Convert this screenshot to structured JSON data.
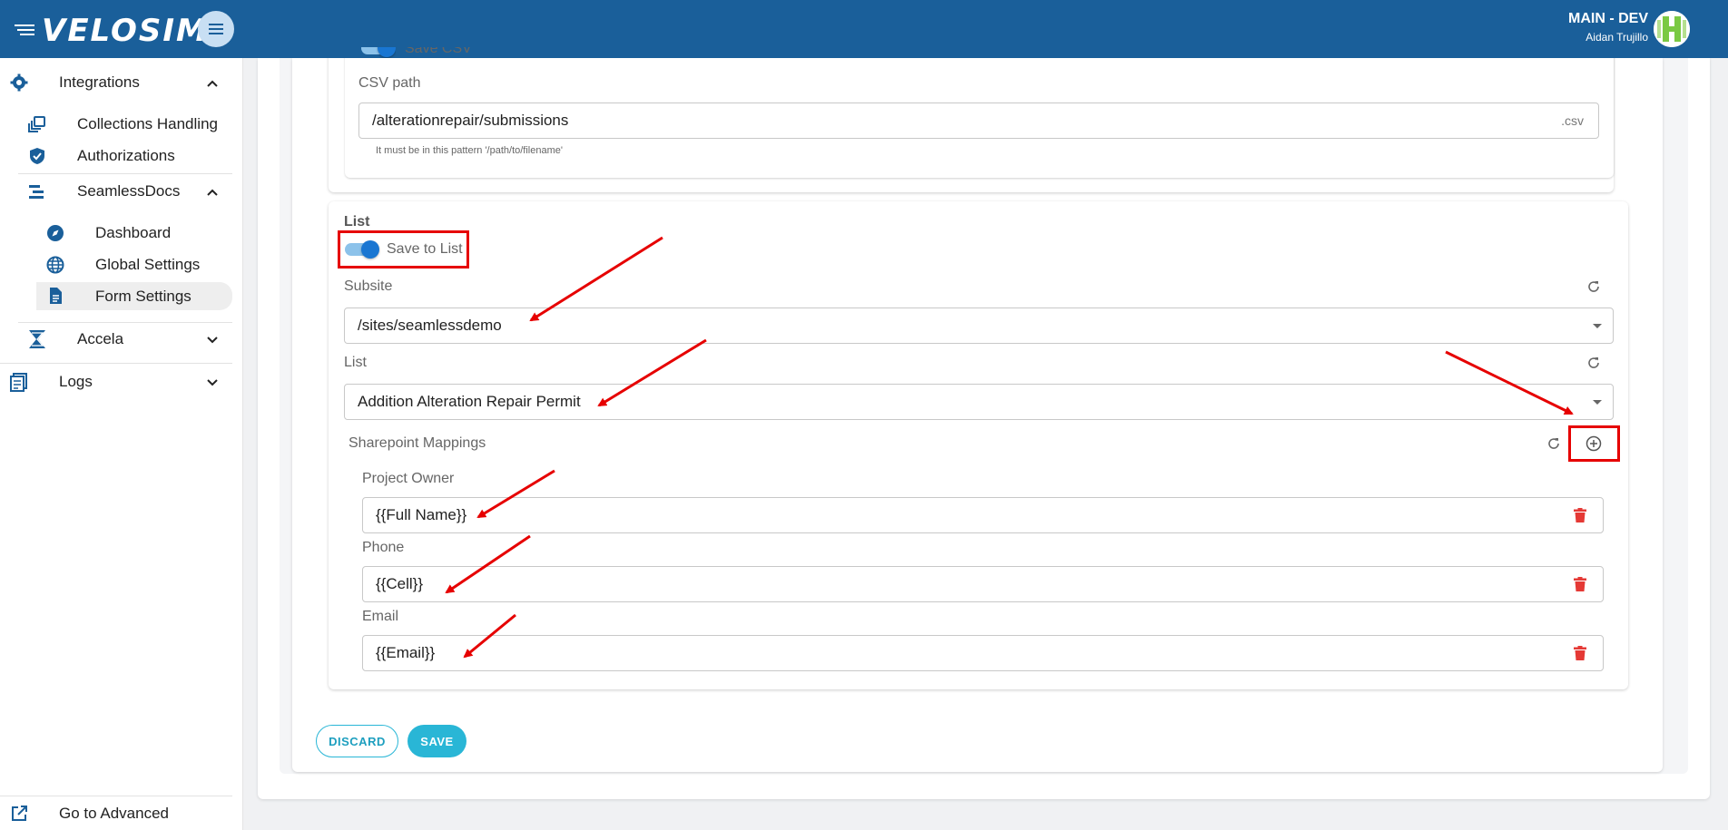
{
  "header": {
    "logo": "VELOSIMO",
    "environment": "MAIN - DEV",
    "user": "Aidan Trujillo"
  },
  "sidebar": {
    "integrations": "Integrations",
    "collections_handling": "Collections Handling",
    "authorizations": "Authorizations",
    "seamlessdocs": "SeamlessDocs",
    "dashboard": "Dashboard",
    "global_settings": "Global Settings",
    "form_settings": "Form Settings",
    "accela": "Accela",
    "logs": "Logs",
    "go_to_advanced": "Go to Advanced"
  },
  "csv": {
    "save_csv_label": "Save CSV",
    "csv_path_label": "CSV path",
    "csv_path_value": "/alterationrepair/submissions",
    "csv_suffix": ".csv",
    "helper": "It must be in this pattern '/path/to/filename'"
  },
  "list": {
    "section_title": "List",
    "save_to_list_label": "Save to List",
    "save_to_list_on": true,
    "subsite_label": "Subsite",
    "subsite_value": "/sites/seamlessdemo",
    "list_label": "List",
    "list_value": "Addition Alteration Repair Permit",
    "mappings_label": "Sharepoint Mappings",
    "mappings": [
      {
        "label": "Project Owner",
        "value": "{{Full Name}}"
      },
      {
        "label": "Phone",
        "value": "{{Cell}}"
      },
      {
        "label": "Email",
        "value": "{{Email}}"
      }
    ]
  },
  "actions": {
    "discard": "DISCARD",
    "save": "SAVE"
  },
  "colors": {
    "header_bg": "#1a5f9a",
    "accent": "#29b6d6",
    "toggle": "#1976d2",
    "delete": "#e53935",
    "annotation": "#e60000"
  }
}
